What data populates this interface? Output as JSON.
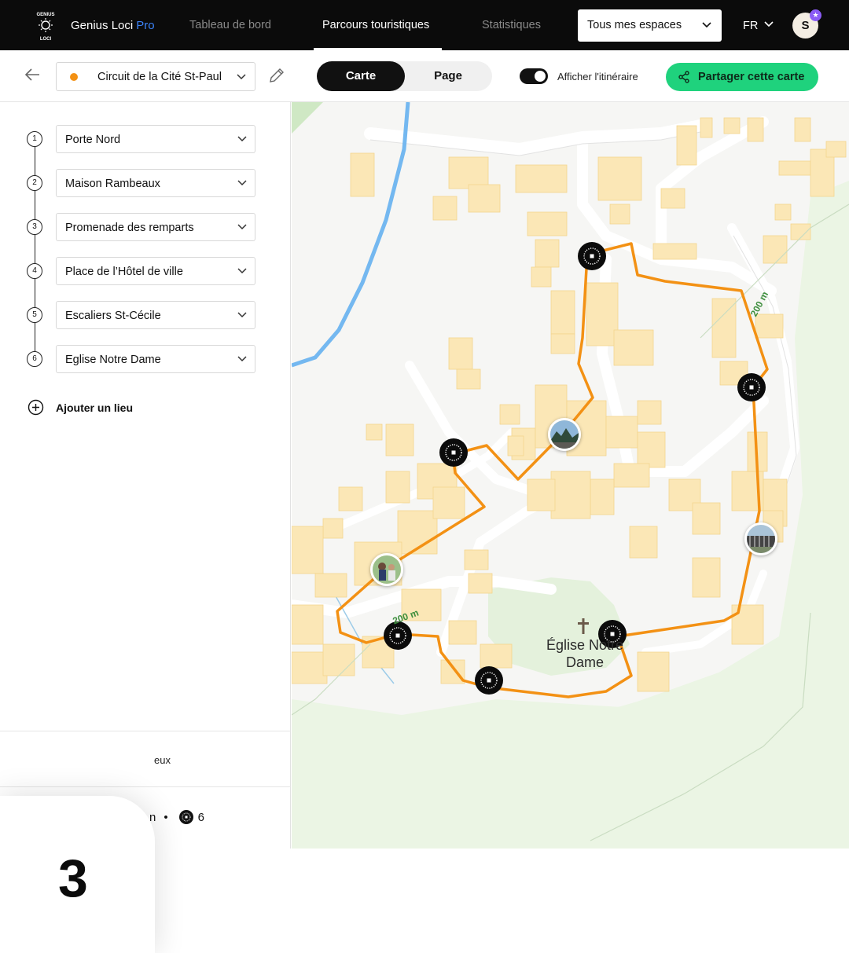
{
  "brand": {
    "name": "Genius Loci",
    "tier": "Pro",
    "logo_text": "GENIUS LOCI"
  },
  "nav": {
    "tabs": [
      {
        "label": "Tableau de bord"
      },
      {
        "label": "Parcours touristiques"
      },
      {
        "label": "Statistiques"
      }
    ],
    "active_tab": "Parcours touristiques",
    "space_select": "Tous mes espaces",
    "language": "FR",
    "user_initial": "S"
  },
  "toolbar": {
    "circuit_name": "Circuit de la Cité St-Paul",
    "view_toggle": [
      "Carte",
      "Page"
    ],
    "active_view": "Carte",
    "show_itinerary_label": "Afficher l'itinéraire",
    "show_itinerary": true,
    "share_label": "Partager cette carte"
  },
  "stops": [
    {
      "num": "1",
      "name": "Porte Nord"
    },
    {
      "num": "2",
      "name": "Maison Rambeaux"
    },
    {
      "num": "3",
      "name": "Promenade des remparts"
    },
    {
      "num": "4",
      "name": "Place de l’Hôtel de ville"
    },
    {
      "num": "5",
      "name": "Escaliers St-Cécile"
    },
    {
      "num": "6",
      "name": "Eglise Notre Dame"
    }
  ],
  "add_place_label": "Ajouter un lieu",
  "summary": {
    "partial_text": "eux",
    "partial_distance": "n",
    "bullet": "•",
    "poi_count": "6"
  },
  "step_card": {
    "number": "3"
  },
  "map": {
    "place_label": "Église Notre Dame",
    "scale_labels": [
      "200 m",
      "200 m"
    ],
    "route_color": "#f39114"
  },
  "colors": {
    "accent": "#1fd27d",
    "route": "#f39114",
    "pro": "#3b82f6",
    "badge": "#8b5cf6"
  }
}
